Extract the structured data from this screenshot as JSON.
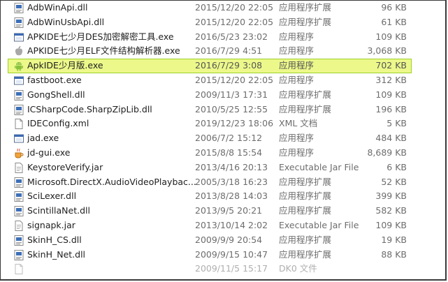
{
  "files": [
    {
      "name": "AdbWinApi.dll",
      "date": "2015/12/20 22:05",
      "type": "应用程序扩展",
      "size": "96 KB",
      "icon": "dll-icon"
    },
    {
      "name": "AdbWinUsbApi.dll",
      "date": "2015/12/20 22:05",
      "type": "应用程序扩展",
      "size": "61 KB",
      "icon": "dll-icon"
    },
    {
      "name": "APKIDE七少月DES加密解密工具.exe",
      "date": "2016/5/23 23:02",
      "type": "应用程序",
      "size": "109 KB",
      "icon": "exe-window-icon"
    },
    {
      "name": "APKIDE七少月ELF文件结构解析器.exe",
      "date": "2016/7/29 4:51",
      "type": "应用程序",
      "size": "3,068 KB",
      "icon": "apple-icon"
    },
    {
      "name": "ApkIDE少月版.exe",
      "date": "2016/7/29 3:08",
      "type": "应用程序",
      "size": "702 KB",
      "icon": "android-icon",
      "selected": true
    },
    {
      "name": "fastboot.exe",
      "date": "2015/12/20 22:05",
      "type": "应用程序",
      "size": "312 KB",
      "icon": "exe-window-icon"
    },
    {
      "name": "GongShell.dll",
      "date": "2009/11/3 17:31",
      "type": "应用程序扩展",
      "size": "109 KB",
      "icon": "dll-icon"
    },
    {
      "name": "ICSharpCode.SharpZipLib.dll",
      "date": "2010/5/25 12:55",
      "type": "应用程序扩展",
      "size": "196 KB",
      "icon": "dll-icon"
    },
    {
      "name": "IDEConfig.xml",
      "date": "2019/12/23 18:06",
      "type": "XML 文档",
      "size": "5 KB",
      "icon": "document-icon"
    },
    {
      "name": "jad.exe",
      "date": "2006/7/2 15:12",
      "type": "应用程序",
      "size": "484 KB",
      "icon": "exe-window-icon"
    },
    {
      "name": "jd-gui.exe",
      "date": "2015/8/8 15:54",
      "type": "应用程序",
      "size": "8,689 KB",
      "icon": "java-icon"
    },
    {
      "name": "KeystoreVerify.jar",
      "date": "2013/4/16 20:13",
      "type": "Executable Jar File",
      "size": "6 KB",
      "icon": "jar-icon"
    },
    {
      "name": "Microsoft.DirectX.AudioVideoPlaybac...",
      "date": "2005/3/18 16:23",
      "type": "应用程序扩展",
      "size": "52 KB",
      "icon": "dll-icon"
    },
    {
      "name": "SciLexer.dll",
      "date": "2013/8/28 14:03",
      "type": "应用程序扩展",
      "size": "399 KB",
      "icon": "dll-icon"
    },
    {
      "name": "ScintillaNet.dll",
      "date": "2013/9/5 20:21",
      "type": "应用程序扩展",
      "size": "582 KB",
      "icon": "dll-icon"
    },
    {
      "name": "signapk.jar",
      "date": "2013/10/14 2:02",
      "type": "Executable Jar File",
      "size": "109 KB",
      "icon": "jar-icon"
    },
    {
      "name": "SkinH_CS.dll",
      "date": "2009/9/9 20:54",
      "type": "应用程序扩展",
      "size": "19 KB",
      "icon": "dll-icon"
    },
    {
      "name": "SkinH_Net.dll",
      "date": "2009/9/15 10:47",
      "type": "应用程序扩展",
      "size": "88 KB",
      "icon": "dll-icon"
    },
    {
      "name": "",
      "date": "2009/11/5 15:17",
      "type": "DK0 文件",
      "size": "",
      "icon": "document-icon",
      "partial": true
    }
  ]
}
